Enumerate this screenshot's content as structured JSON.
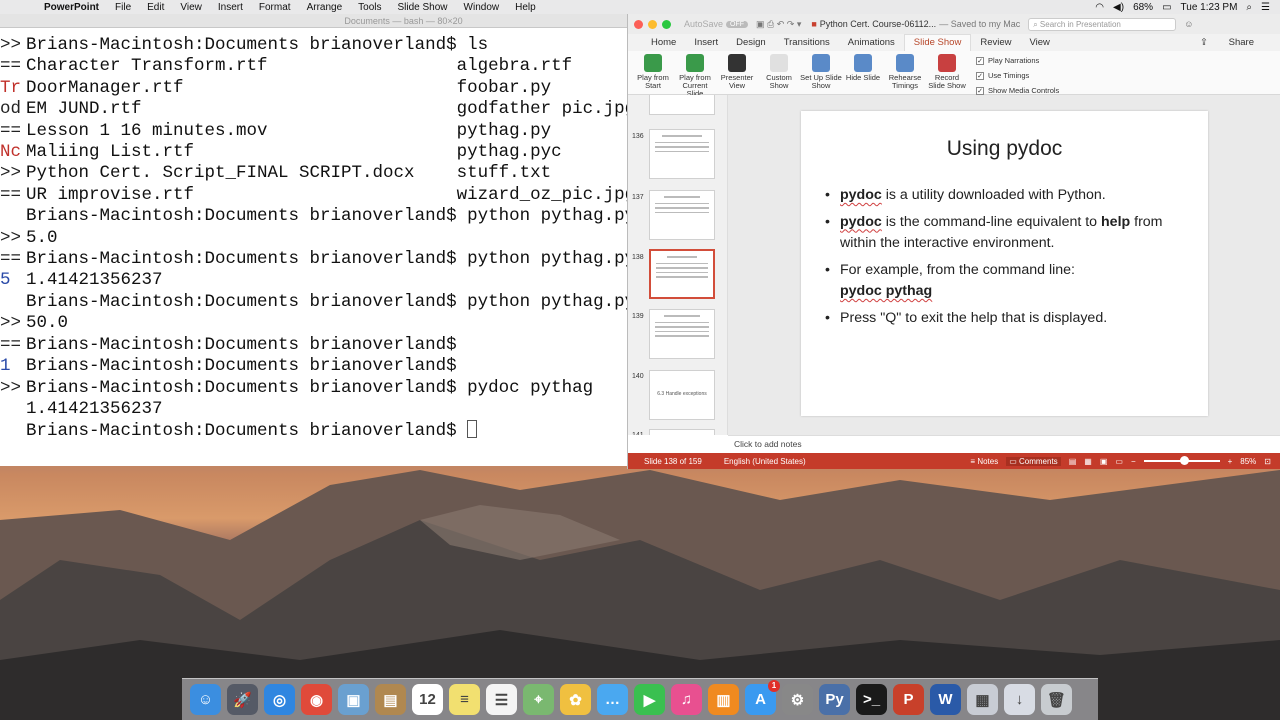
{
  "menubar": {
    "apple": "",
    "app": "PowerPoint",
    "items": [
      "File",
      "Edit",
      "View",
      "Insert",
      "Format",
      "Arrange",
      "Tools",
      "Slide Show",
      "Window",
      "Help"
    ],
    "battery": "68%",
    "clock": "Tue 1:23 PM"
  },
  "terminal": {
    "title": "Documents — bash — 80×20",
    "lines": [
      "Brians-Macintosh:Documents brianoverland$ ls",
      "Character Transform.rtf                  algebra.rtf",
      "DoorManager.rtf                          foobar.py",
      "EM JUND.rtf                              godfather pic.jpg",
      "Lesson 1 16 minutes.mov                  pythag.py",
      "Maliing List.rtf                         pythag.pyc",
      "Python Cert. Script_FINAL SCRIPT.docx    stuff.txt",
      "UR improvise.rtf                         wizard_oz_pic.jpg",
      "Brians-Macintosh:Documents brianoverland$ python pythag.py",
      "5.0",
      "Brians-Macintosh:Documents brianoverland$ python pythag.py",
      "1.41421356237",
      "Brians-Macintosh:Documents brianoverland$ python pythag.py",
      "50.0",
      "Brians-Macintosh:Documents brianoverland$",
      "Brians-Macintosh:Documents brianoverland$",
      "Brians-Macintosh:Documents brianoverland$ pydoc pythag",
      "1.41421356237",
      "",
      "Brians-Macintosh:Documents brianoverland$ "
    ],
    "left_clip": [
      ">>",
      "==",
      "Tr",
      "od",
      "==",
      "Nc",
      ">>",
      "==",
      ">>",
      "==",
      "5",
      ">>",
      "==",
      "1",
      ">>"
    ]
  },
  "ppt": {
    "autosave": "AutoSave",
    "autosave_state": "OFF",
    "doc_title": "Python Cert. Course-06112...",
    "saved": "— Saved to my Mac",
    "search_placeholder": "Search in Presentation",
    "tabs": [
      "Home",
      "Insert",
      "Design",
      "Transitions",
      "Animations",
      "Slide Show",
      "Review",
      "View"
    ],
    "active_tab": "Slide Show",
    "share": "Share",
    "ribbon": [
      {
        "label": "Play from Start",
        "color": "#3a9a4a"
      },
      {
        "label": "Play from Current Slide",
        "color": "#3a9a4a"
      },
      {
        "label": "Presenter View",
        "color": "#333333"
      },
      {
        "label": "Custom Show",
        "color": "#e0e0e0"
      },
      {
        "label": "Set Up Slide Show",
        "color": "#5a8ac8"
      },
      {
        "label": "Hide Slide",
        "color": "#5a8ac8"
      },
      {
        "label": "Rehearse Timings",
        "color": "#5a8ac8"
      },
      {
        "label": "Record Slide Show",
        "color": "#c84040"
      }
    ],
    "checks": [
      "Play Narrations",
      "Use Timings",
      "Show Media Controls"
    ],
    "thumbs": [
      {
        "num": "136"
      },
      {
        "num": "137"
      },
      {
        "num": "138"
      },
      {
        "num": "139"
      },
      {
        "num": "140",
        "text": "6.3 Handle exceptions"
      },
      {
        "num": "141"
      }
    ],
    "slide": {
      "title": "Using pydoc",
      "b1_kw": "pydoc",
      "b1_rest": " is a utility downloaded with Python.",
      "b2_kw": "pydoc",
      "b2_mid": " is the command-line equivalent to ",
      "b2_kw2": "help",
      "b2_end": " from within the interactive environment.",
      "b3_text": "For example, from the command line:",
      "b3_cmd": "pydoc pythag",
      "b4": "Press \"Q\" to exit the help that is displayed."
    },
    "notes": "Click to add notes",
    "status": {
      "slide": "Slide 138 of 159",
      "lang": "English (United States)",
      "notes": "Notes",
      "comments": "Comments",
      "zoom": "85%"
    }
  },
  "dock": [
    {
      "name": "finder",
      "color": "#3b8ee0",
      "g": "☺"
    },
    {
      "name": "launchpad",
      "color": "#555a66",
      "g": "🚀"
    },
    {
      "name": "safari",
      "color": "#2f86e0",
      "g": "◎"
    },
    {
      "name": "chrome",
      "color": "#e04a3a",
      "g": "◉"
    },
    {
      "name": "preview",
      "color": "#6aa0d0",
      "g": "▣"
    },
    {
      "name": "contacts",
      "color": "#b08850",
      "g": "▤"
    },
    {
      "name": "calendar",
      "color": "#ffffff",
      "g": "12"
    },
    {
      "name": "notes",
      "color": "#f2e070",
      "g": "≡"
    },
    {
      "name": "reminders",
      "color": "#f4f4f4",
      "g": "☰"
    },
    {
      "name": "maps",
      "color": "#7ab870",
      "g": "⌖"
    },
    {
      "name": "photos",
      "color": "#f0c040",
      "g": "✿"
    },
    {
      "name": "messages",
      "color": "#4aa8f0",
      "g": "…"
    },
    {
      "name": "facetime",
      "color": "#3ac050",
      "g": "▶"
    },
    {
      "name": "itunes",
      "color": "#e85090",
      "g": "♫"
    },
    {
      "name": "ibooks",
      "color": "#f08a20",
      "g": "▥"
    },
    {
      "name": "app-store",
      "color": "#3a9af0",
      "g": "A"
    },
    {
      "name": "system-prefs",
      "color": "#888888",
      "g": "⚙"
    },
    {
      "name": "python-launcher",
      "color": "#4a70a8",
      "g": "Py"
    },
    {
      "name": "terminal",
      "color": "#1a1a1a",
      "g": ">_"
    },
    {
      "name": "powerpoint",
      "color": "#c8402a",
      "g": "P"
    },
    {
      "name": "word",
      "color": "#2a5aa8",
      "g": "W"
    },
    {
      "name": "folder",
      "color": "#c8ccd4",
      "g": "▦"
    },
    {
      "name": "downloads",
      "color": "#d8dce4",
      "g": "↓"
    },
    {
      "name": "trash",
      "color": "#c8ccd0",
      "g": "🗑"
    }
  ],
  "dock_badge": "1"
}
